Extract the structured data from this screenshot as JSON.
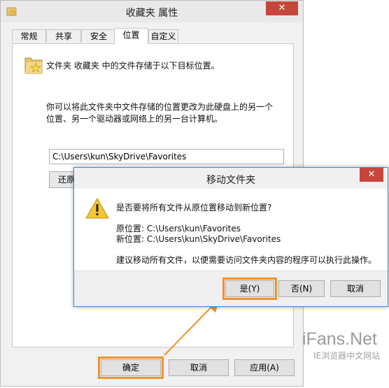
{
  "properties_window": {
    "title": "收藏夹 属性",
    "close_label": "✕",
    "tabs": [
      {
        "label": "常规",
        "active": false
      },
      {
        "label": "共享",
        "active": false
      },
      {
        "label": "安全",
        "active": false
      },
      {
        "label": "位置",
        "active": true
      },
      {
        "label": "自定义",
        "active": false
      }
    ],
    "location_tab": {
      "description": "文件夹 收藏夹 中的文件存储于以下目标位置。",
      "explanation_line1": "你可以将此文件夹中文件存储的位置更改为此硬盘上的另一个",
      "explanation_line2": "位置、另一个驱动器或网络上的另一台计算机。",
      "path_value": "C:\\Users\\kun\\SkyDrive\\Favorites",
      "restore_label": "还原"
    },
    "buttons": {
      "ok": "确定",
      "cancel": "取消",
      "apply": "应用(A)"
    }
  },
  "move_dialog": {
    "title": "移动文件夹",
    "close_label": "✕",
    "question": "是否要将所有文件从原位置移动到新位置?",
    "original_location": "原位置: C:\\Users\\kun\\Favorites",
    "new_location": "新位置: C:\\Users\\kun\\SkyDrive\\Favorites",
    "advice": "建议移动所有文件，以便需要访问文件夹内容的程序可以执行此操作。",
    "buttons": {
      "yes": "是(Y)",
      "no": "否(N)",
      "cancel": "取消"
    }
  },
  "watermark": {
    "brand": "iFans.Net",
    "subtitle": "IE浏览器中文网站"
  },
  "colors": {
    "highlight": "#f0922b",
    "close_button": "#c7463b",
    "dialog_border": "#3a8bd6"
  },
  "icons": [
    "folder-star-icon",
    "warning-icon",
    "close-icon"
  ]
}
